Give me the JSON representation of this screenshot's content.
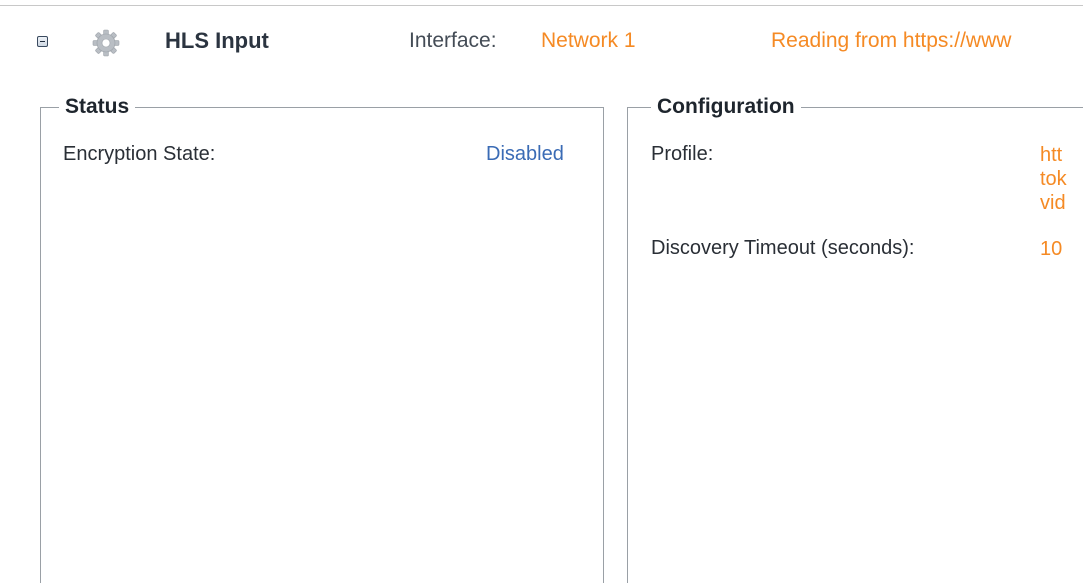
{
  "header": {
    "module_title": "HLS Input",
    "interface_label": "Interface:",
    "interface_value": "Network 1",
    "reading_text": "Reading from https://www"
  },
  "icons": {
    "collapse": "collapse-minus-icon",
    "module": "gear-icon"
  },
  "status": {
    "legend": "Status",
    "fields": [
      {
        "label": "Encryption State:",
        "value": "Disabled"
      }
    ]
  },
  "configuration": {
    "legend": "Configuration",
    "fields": [
      {
        "label": "Profile:",
        "value_lines": [
          "htt",
          "tok",
          "vid"
        ]
      },
      {
        "label": "Discovery Timeout (seconds):",
        "value": "10"
      }
    ]
  },
  "colors": {
    "accent_orange": "#f58a24",
    "link_blue": "#3a6bb5",
    "border_gray": "#9aa0a6"
  }
}
